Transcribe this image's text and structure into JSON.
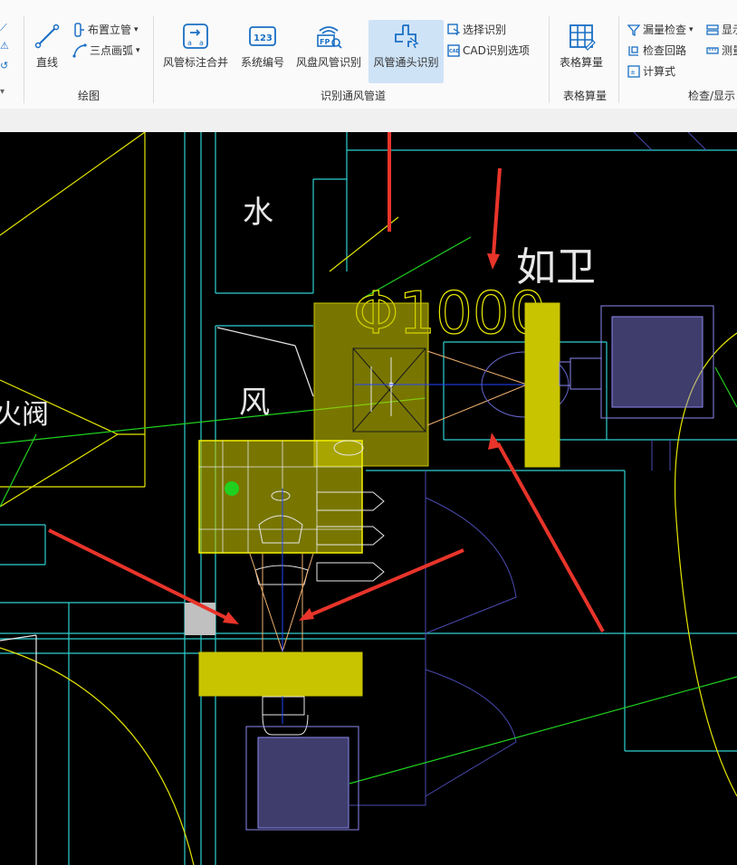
{
  "ribbon": {
    "draw": {
      "line_label": "直线",
      "riser_label": "布置立管",
      "arc_label": "三点画弧",
      "group_label": "绘图"
    },
    "duct": {
      "merge_label": "风管标注合并",
      "sysno_label": "系统编号",
      "fancoil_label": "风盘风管识别",
      "fitting_label": "风管通头识别",
      "select_label": "选择识别",
      "cadopt_label": "CAD识别选项",
      "group_label": "识别通风管道"
    },
    "table": {
      "calc_label": "表格算量",
      "group_label": "表格算量"
    },
    "check": {
      "leak_label": "漏量检查",
      "loop_label": "检查回路",
      "formula_label": "计算式",
      "show_label": "显示",
      "measure_label": "测量",
      "group_label": "检查/显示"
    }
  },
  "drawing": {
    "text_water": "水",
    "text_wind": "风",
    "text_valve": "火阀",
    "text_diameter": "Φ1000",
    "text_toilet": "如卫"
  },
  "colors": {
    "duct_fill": "#c8c400",
    "grille": "#8c88f0",
    "cyan_line": "#2fd0d0",
    "green_line": "#20d020",
    "yellow_line": "#e6e600",
    "arrow_red": "#e8342a",
    "ribbon_active": "#cfe3f7"
  }
}
